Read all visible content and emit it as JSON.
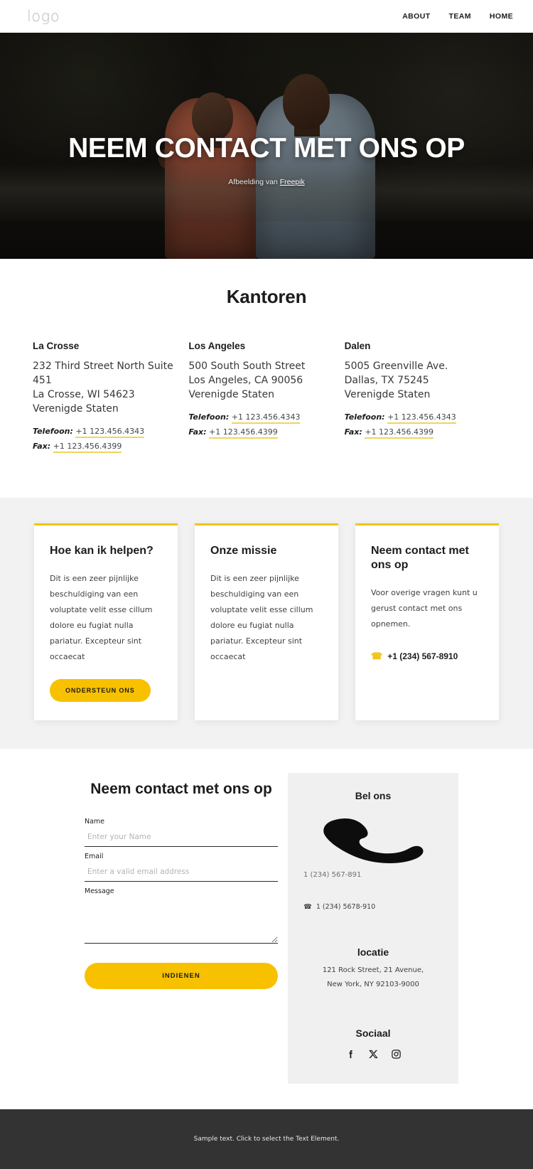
{
  "header": {
    "logo": "logo",
    "nav": [
      {
        "label": "ABOUT"
      },
      {
        "label": "TEAM"
      },
      {
        "label": "HOME"
      }
    ]
  },
  "hero": {
    "title": "NEEM CONTACT MET ONS OP",
    "credit_prefix": "Afbeelding van ",
    "credit_link": "Freepik"
  },
  "offices": {
    "title": "Kantoren",
    "phone_label": "Telefoon:",
    "fax_label": "Fax:",
    "items": [
      {
        "name": "La Crosse",
        "address": "232 Third Street North Suite 451\nLa Crosse, WI 54623\nVerenigde Staten",
        "phone": "+1 123.456.4343",
        "fax": "+1 123.456.4399"
      },
      {
        "name": "Los Angeles",
        "address": "500 South South Street\nLos Angeles, CA 90056\nVerenigde Staten",
        "phone": "+1 123.456.4343",
        "fax": "+1 123.456.4399"
      },
      {
        "name": "Dalen",
        "address": "5005 Greenville Ave.\nDallas, TX 75245\nVerenigde Staten",
        "phone": "+1 123.456.4343",
        "fax": "+1 123.456.4399"
      }
    ]
  },
  "cards": [
    {
      "title": "Hoe kan ik helpen?",
      "body": "Dit is een zeer pijnlijke beschuldiging van een voluptate velit esse cillum dolore eu fugiat nulla pariatur. Excepteur sint occaecat",
      "cta": "ONDERSTEUN ONS"
    },
    {
      "title": "Onze missie",
      "body": "Dit is een zeer pijnlijke beschuldiging van een voluptate velit esse cillum dolore eu fugiat nulla pariatur. Excepteur sint occaecat"
    },
    {
      "title": "Neem contact met ons op",
      "body": "Voor overige vragen kunt u gerust contact met ons opnemen.",
      "phone": "+1 (234) 567-8910",
      "phone_icon": "phone-icon"
    }
  ],
  "contact": {
    "form_title": "Neem contact met ons op",
    "fields": [
      {
        "label": "Name",
        "placeholder": "Enter your Name",
        "value": ""
      },
      {
        "label": "Email",
        "placeholder": "Enter a valid email address",
        "value": ""
      },
      {
        "label": "Message",
        "placeholder": "",
        "value": ""
      }
    ],
    "submit_label": "INDIENEN"
  },
  "aside": {
    "call_title": "Bel ons",
    "call_icon": "phone-handset-icon",
    "phone_primary": "1 (234) 567-891",
    "phone_secondary": "1 (234) 5678-910",
    "location_title": "locatie",
    "location_text": "121 Rock Street, 21 Avenue,\nNew York, NY 92103-9000",
    "social_title": "Sociaal",
    "social": [
      {
        "name": "facebook-icon"
      },
      {
        "name": "x-twitter-icon"
      },
      {
        "name": "instagram-icon"
      }
    ]
  },
  "footer": {
    "text": "Sample text. Click to select the Text Element."
  },
  "colors": {
    "accent": "#f8c100",
    "underline": "#f1d45e",
    "footer_bg": "#333333",
    "panel_bg": "#f0f0f0",
    "section_bg": "#f2f2f2"
  }
}
